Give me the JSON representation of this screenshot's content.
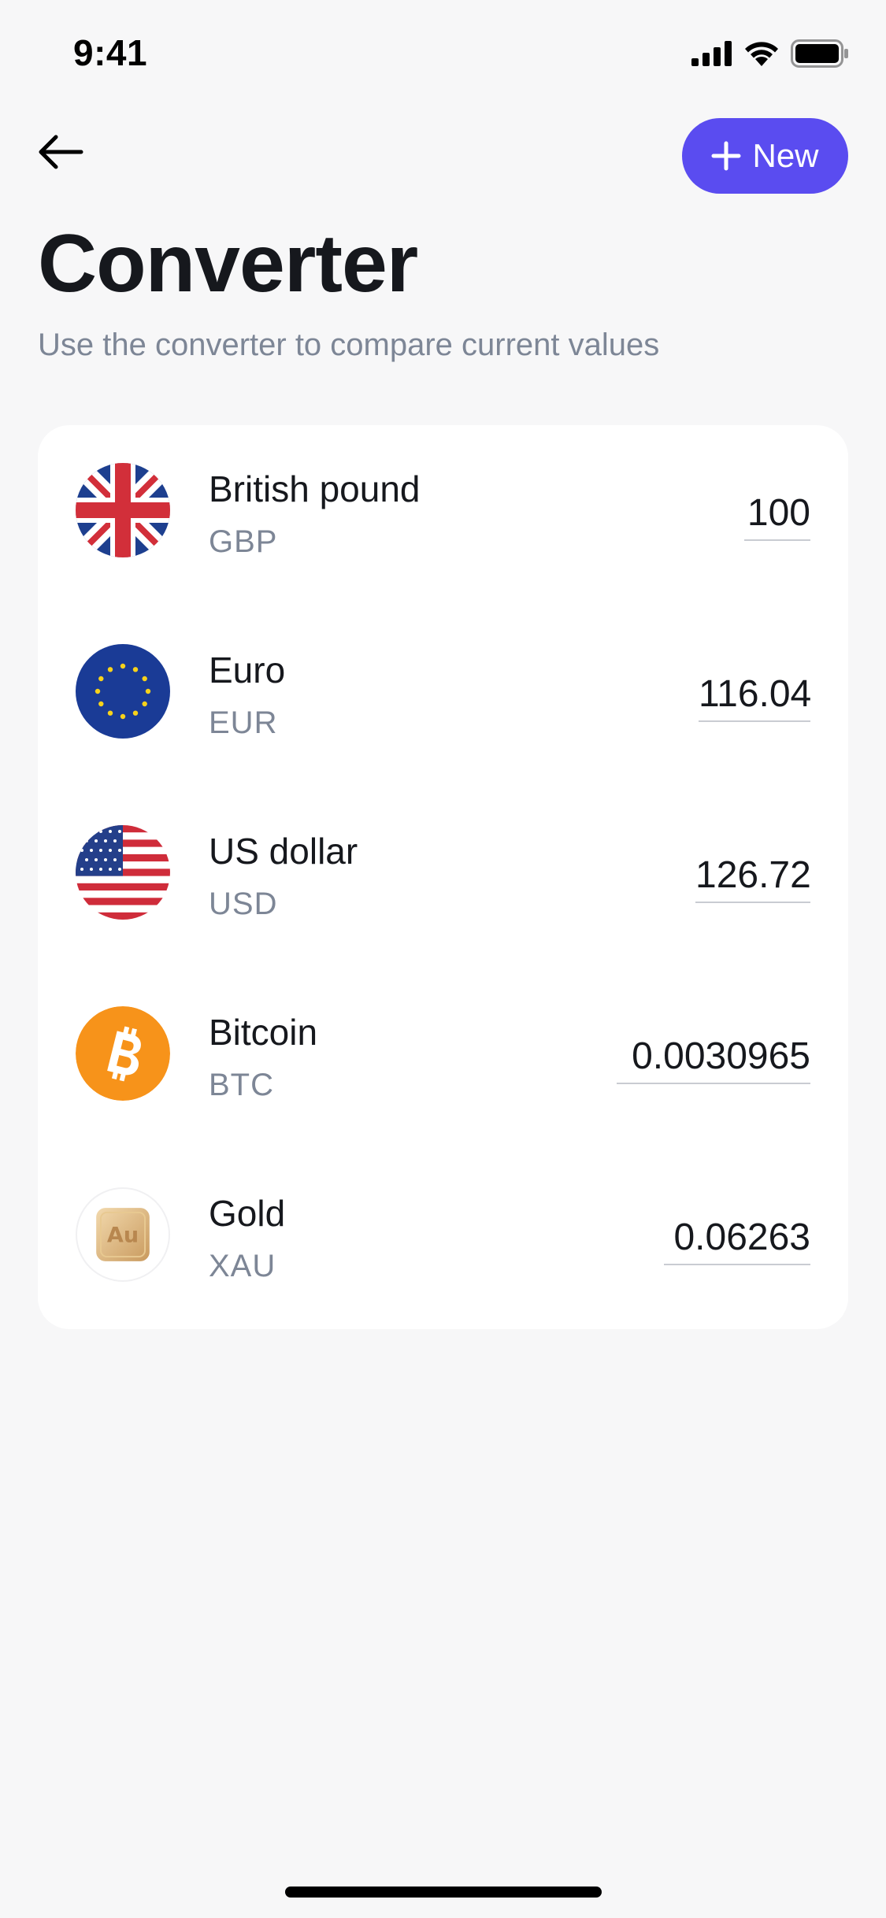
{
  "status_bar": {
    "time": "9:41",
    "icons": [
      "cellular-signal-icon",
      "wifi-icon",
      "battery-icon"
    ]
  },
  "header": {
    "back_icon": "arrow-left-icon",
    "new_button_label": "New",
    "new_button_icon": "plus-icon",
    "title": "Converter",
    "subtitle": "Use the converter to compare current values"
  },
  "colors": {
    "accent": "#5a4cf0",
    "background": "#f7f7f8",
    "card": "#ffffff",
    "text_primary": "#16181d",
    "text_secondary": "#7d8696"
  },
  "currencies": [
    {
      "name": "British pound",
      "code": "GBP",
      "value": "100",
      "icon": "uk-flag-icon"
    },
    {
      "name": "Euro",
      "code": "EUR",
      "value": "116.04",
      "icon": "eu-flag-icon"
    },
    {
      "name": "US dollar",
      "code": "USD",
      "value": "126.72",
      "icon": "us-flag-icon"
    },
    {
      "name": "Bitcoin",
      "code": "BTC",
      "value": "0.0030965",
      "icon": "bitcoin-icon"
    },
    {
      "name": "Gold",
      "code": "XAU",
      "value": "0.06263",
      "icon": "gold-bar-icon",
      "icon_text": "Au"
    }
  ]
}
